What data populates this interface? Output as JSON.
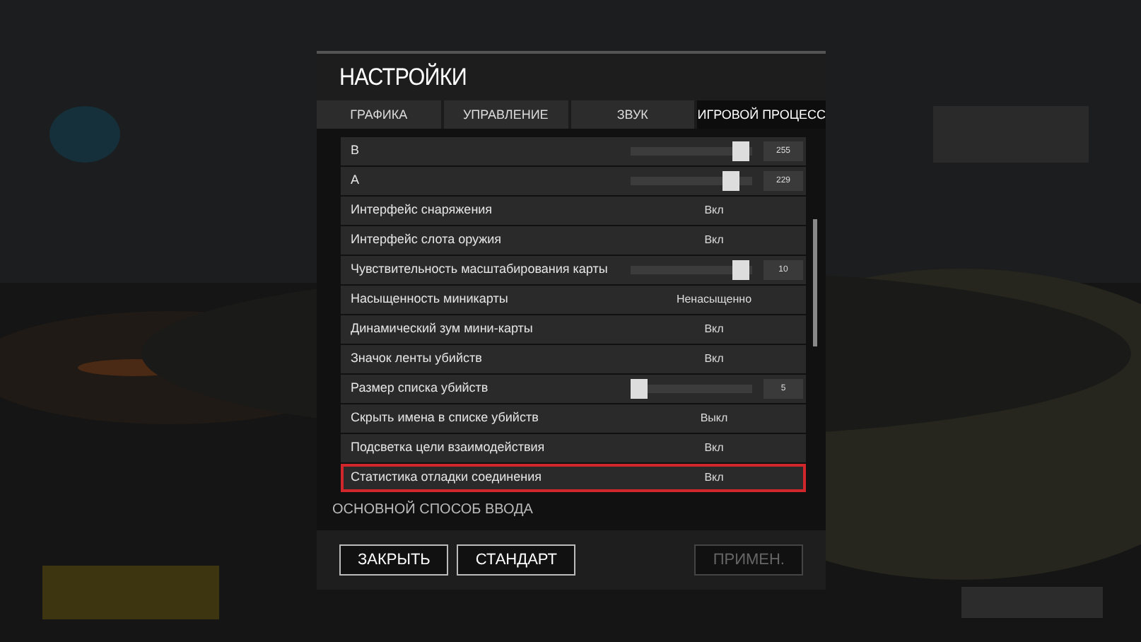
{
  "dialog": {
    "title": "НАСТРОЙКИ",
    "tabs": [
      {
        "label": "ГРАФИКА",
        "selected": false
      },
      {
        "label": "УПРАВЛЕНИЕ",
        "selected": false
      },
      {
        "label": "ЗВУК",
        "selected": false
      },
      {
        "label": "ИГРОВОЙ ПРОЦЕСС",
        "selected": true
      }
    ],
    "settings": [
      {
        "kind": "slider",
        "label": "B",
        "level": 0.97,
        "value": "255",
        "highlighted": false
      },
      {
        "kind": "slider",
        "label": "A",
        "level": 0.88,
        "value": "229",
        "highlighted": false
      },
      {
        "kind": "option",
        "label": "Интерфейс снаряжения",
        "value": "Вкл",
        "highlighted": false
      },
      {
        "kind": "option",
        "label": "Интерфейс слота оружия",
        "value": "Вкл",
        "highlighted": false
      },
      {
        "kind": "slider",
        "label": "Чувствительность масштабирования карты",
        "level": 0.97,
        "value": "10",
        "highlighted": false
      },
      {
        "kind": "option",
        "label": "Насыщенность миникарты",
        "value": "Ненасыщенно",
        "highlighted": false
      },
      {
        "kind": "option",
        "label": "Динамический зум мини-карты",
        "value": "Вкл",
        "highlighted": false
      },
      {
        "kind": "option",
        "label": "Значок ленты убийств",
        "value": "Вкл",
        "highlighted": false
      },
      {
        "kind": "slider",
        "label": "Размер списка убийств",
        "level": 0,
        "value": "5",
        "highlighted": false
      },
      {
        "kind": "option",
        "label": "Скрыть имена в списке убийств",
        "value": "Выкл",
        "highlighted": false
      },
      {
        "kind": "option",
        "label": "Подсветка цели взаимодействия",
        "value": "Вкл",
        "highlighted": false
      },
      {
        "kind": "option",
        "label": "Статистика отладки соединения",
        "value": "Вкл",
        "highlighted": true
      }
    ],
    "section_heading": "ОСНОВНОЙ СПОСОБ ВВОДА",
    "buttons": [
      {
        "label": "ЗАКРЫТЬ",
        "disabled": false
      },
      {
        "label": "СТАНДАРТ",
        "disabled": false
      },
      {
        "label": "ПРИМЕН.",
        "disabled": true
      }
    ]
  }
}
